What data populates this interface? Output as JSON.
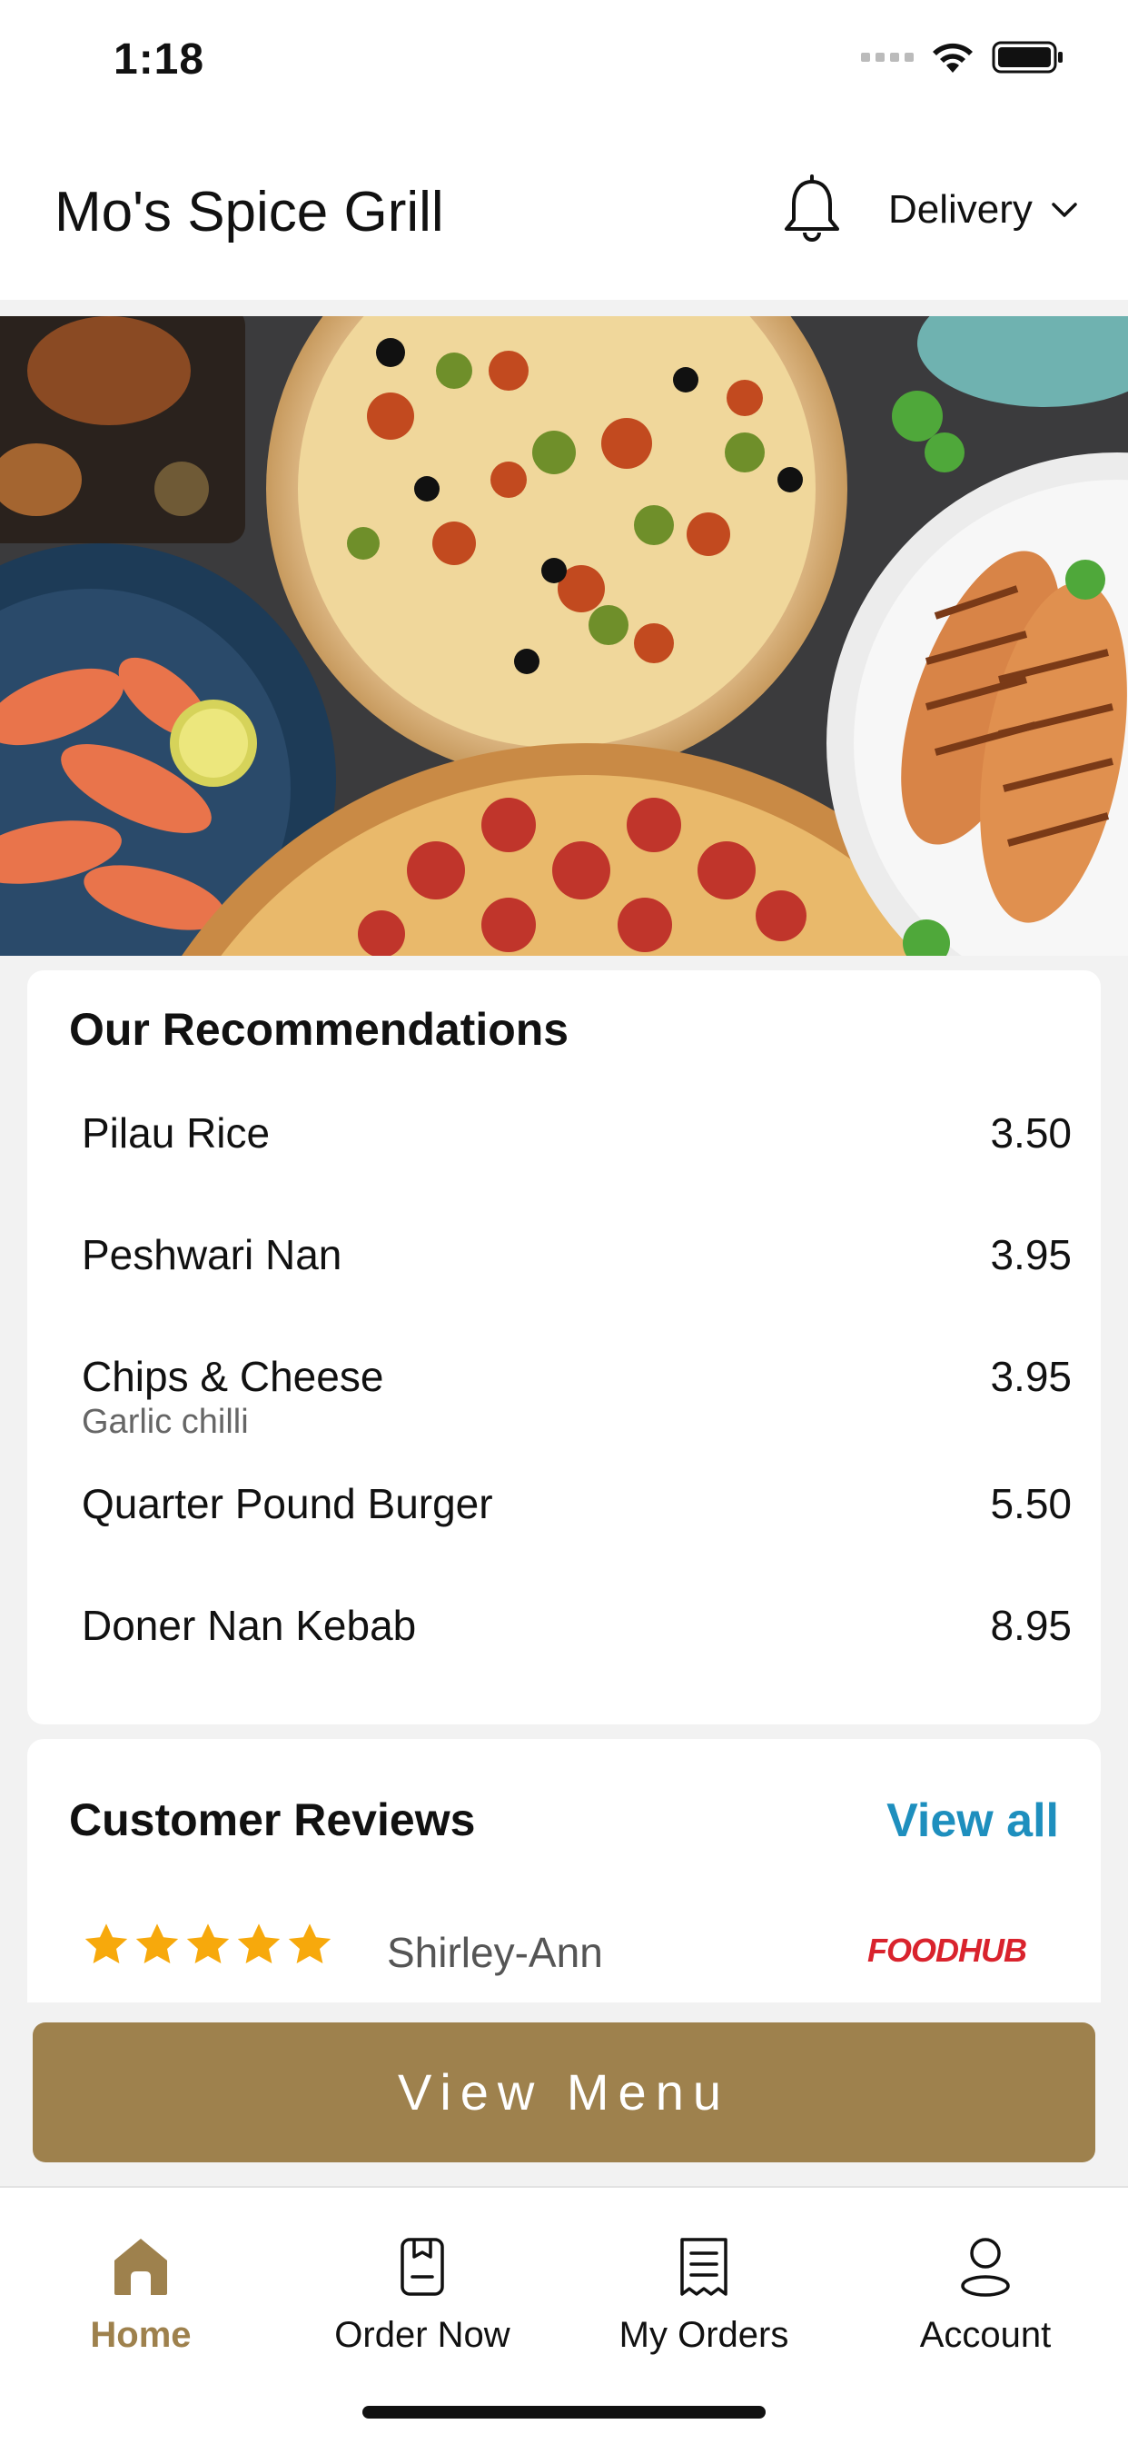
{
  "status_bar": {
    "time": "1:18"
  },
  "header": {
    "title": "Mo's Spice Grill",
    "mode": "Delivery"
  },
  "hero": {
    "icon": "food-banner-image"
  },
  "recommendations": {
    "title": "Our Recommendations",
    "items": [
      {
        "name": "Pilau Rice",
        "price": "3.50",
        "description": ""
      },
      {
        "name": "Peshwari Nan",
        "price": "3.95",
        "description": ""
      },
      {
        "name": "Chips & Cheese",
        "price": "3.95",
        "description": "Garlic chilli"
      },
      {
        "name": "Quarter Pound Burger",
        "price": "5.50",
        "description": ""
      },
      {
        "name": "Doner Nan Kebab",
        "price": "8.95",
        "description": ""
      }
    ]
  },
  "reviews": {
    "title": "Customer Reviews",
    "view_all": "View all",
    "items": [
      {
        "reviewer": "Shirley-Ann",
        "rating": 5,
        "source": "FOODHUB"
      }
    ]
  },
  "cta": {
    "label": "View Menu"
  },
  "nav": {
    "items": [
      {
        "label": "Home",
        "icon": "home-icon",
        "active": true
      },
      {
        "label": "Order Now",
        "icon": "order-icon",
        "active": false
      },
      {
        "label": "My Orders",
        "icon": "receipt-icon",
        "active": false
      },
      {
        "label": "Account",
        "icon": "user-icon",
        "active": false
      }
    ]
  },
  "colors": {
    "accent": "#9e814d",
    "link": "#1e8fbe",
    "star": "#f7a90c",
    "brand_red": "#d9232d"
  }
}
